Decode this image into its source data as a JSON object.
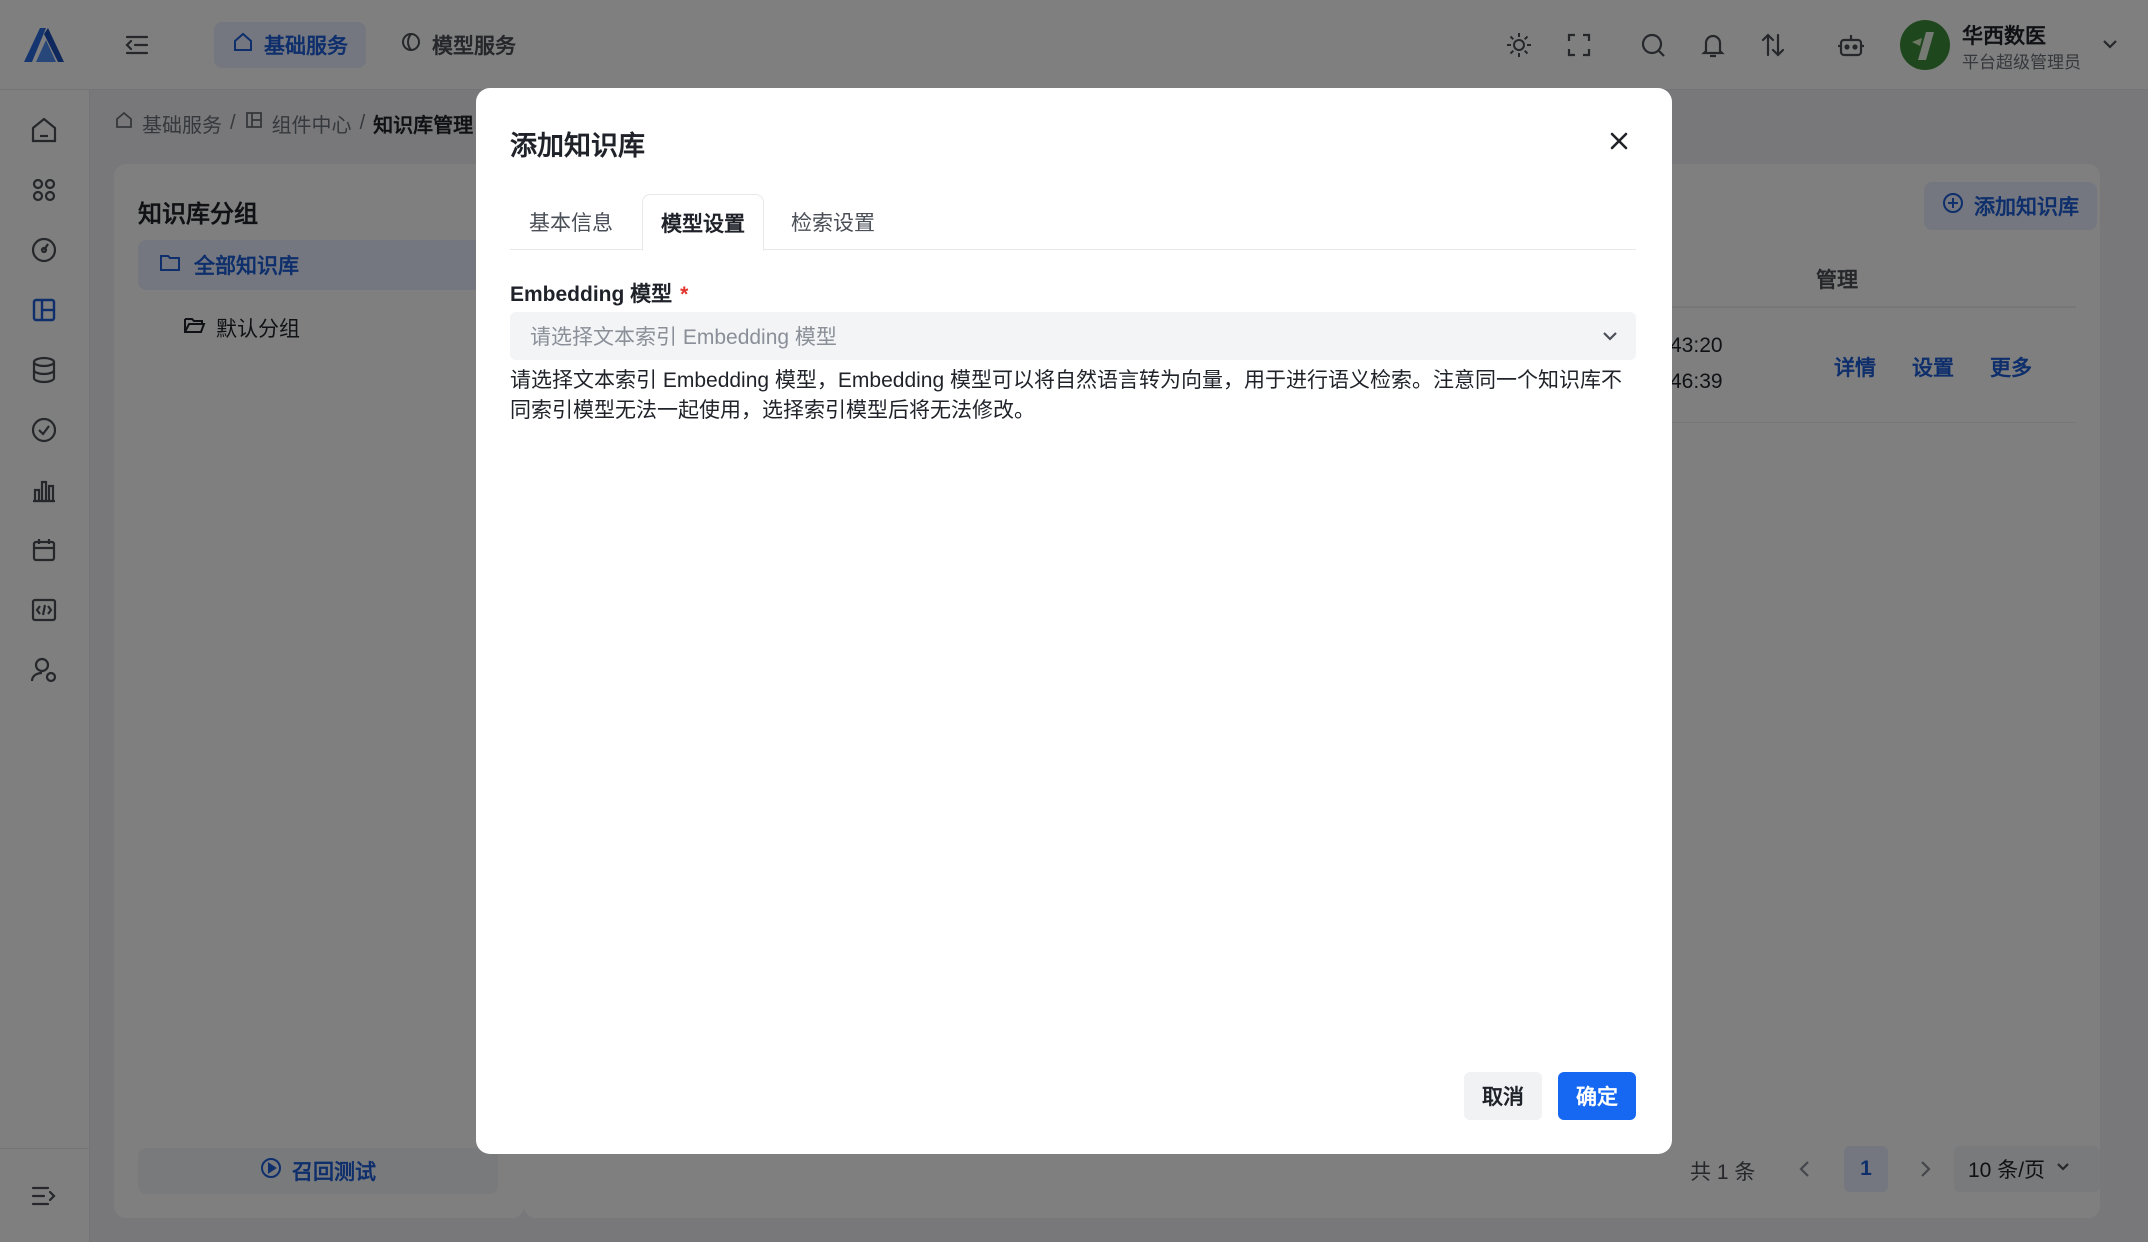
{
  "topbar": {
    "tabs": [
      {
        "label": "基础服务",
        "icon": "home-icon"
      },
      {
        "label": "模型服务",
        "icon": "model-icon"
      }
    ],
    "tools": [
      "sun-icon",
      "fullscreen-icon",
      "search-icon",
      "bell-icon",
      "sort-icon",
      "robot-icon"
    ],
    "user": {
      "name": "华西数医",
      "role": "平台超级管理员"
    }
  },
  "breadcrumb": {
    "items": [
      "基础服务",
      "组件中心"
    ],
    "current": "知识库管理"
  },
  "groups_panel": {
    "title": "知识库分组",
    "all_label": "全部知识库",
    "default_label": "默认分组",
    "recall_label": "召回测试"
  },
  "list_panel": {
    "add_button": "添加知识库",
    "manage_header": "管理",
    "time_line_1": "43:20",
    "time_line_2": "46:39",
    "actions": [
      "详情",
      "设置",
      "更多"
    ],
    "pager": {
      "total": "共 1 条",
      "page": "1",
      "size": "10 条/页"
    }
  },
  "modal": {
    "title": "添加知识库",
    "tabs": [
      "基本信息",
      "模型设置",
      "检索设置"
    ],
    "active_tab": 1,
    "field_label": "Embedding 模型",
    "required_mark": "*",
    "select_placeholder": "请选择文本索引 Embedding 模型",
    "help_text": "请选择文本索引 Embedding 模型，Embedding 模型可以将自然语言转为向量，用于进行语义检索。注意同一个知识库不同索引模型无法一起使用，选择索引模型后将无法修改。",
    "cancel_label": "取消",
    "ok_label": "确定"
  },
  "colors": {
    "accent": "#1668f2",
    "brand": "#1d5fd8",
    "required": "#e0342d",
    "overlay": "rgba(0,0,0,0.5)"
  }
}
